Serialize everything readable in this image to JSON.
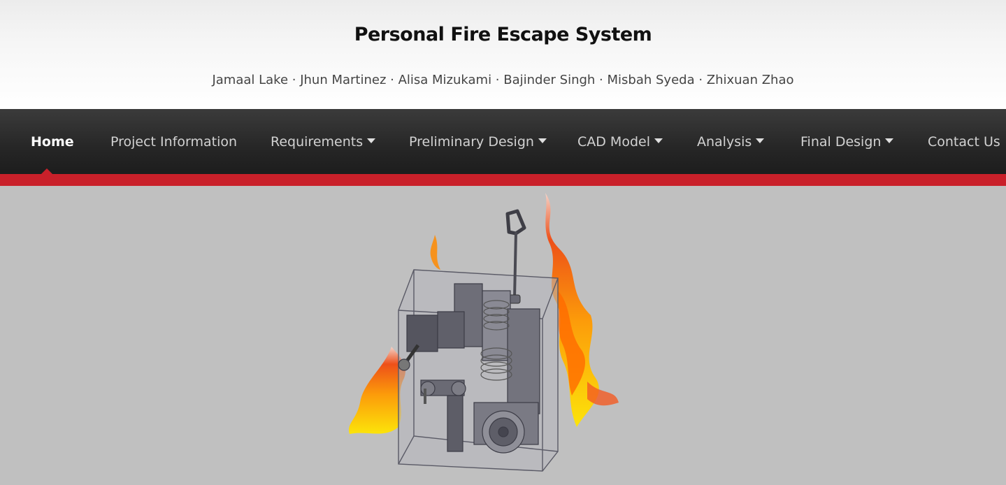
{
  "header": {
    "title": "Personal Fire Escape System",
    "authors": "Jamaal Lake · Jhun Martinez · Alisa Mizukami · Bajinder Singh · Misbah Syeda · Zhixuan Zhao"
  },
  "nav": {
    "items": [
      {
        "label": "Home",
        "active": true,
        "dropdown": false
      },
      {
        "label": "Project Information",
        "active": false,
        "dropdown": false
      },
      {
        "label": "Requirements",
        "active": false,
        "dropdown": true
      },
      {
        "label": "Preliminary Design",
        "active": false,
        "dropdown": true
      },
      {
        "label": "CAD Model",
        "active": false,
        "dropdown": true
      },
      {
        "label": "Analysis",
        "active": false,
        "dropdown": true
      },
      {
        "label": "Final Design",
        "active": false,
        "dropdown": true
      },
      {
        "label": "Contact Us",
        "active": false,
        "dropdown": false
      }
    ]
  },
  "colors": {
    "accent": "#c9202a",
    "nav_bg": "#262626",
    "hero_bg": "#c0c0c0"
  },
  "hero": {
    "icon": "cad-render-fire-escape-device-image"
  }
}
